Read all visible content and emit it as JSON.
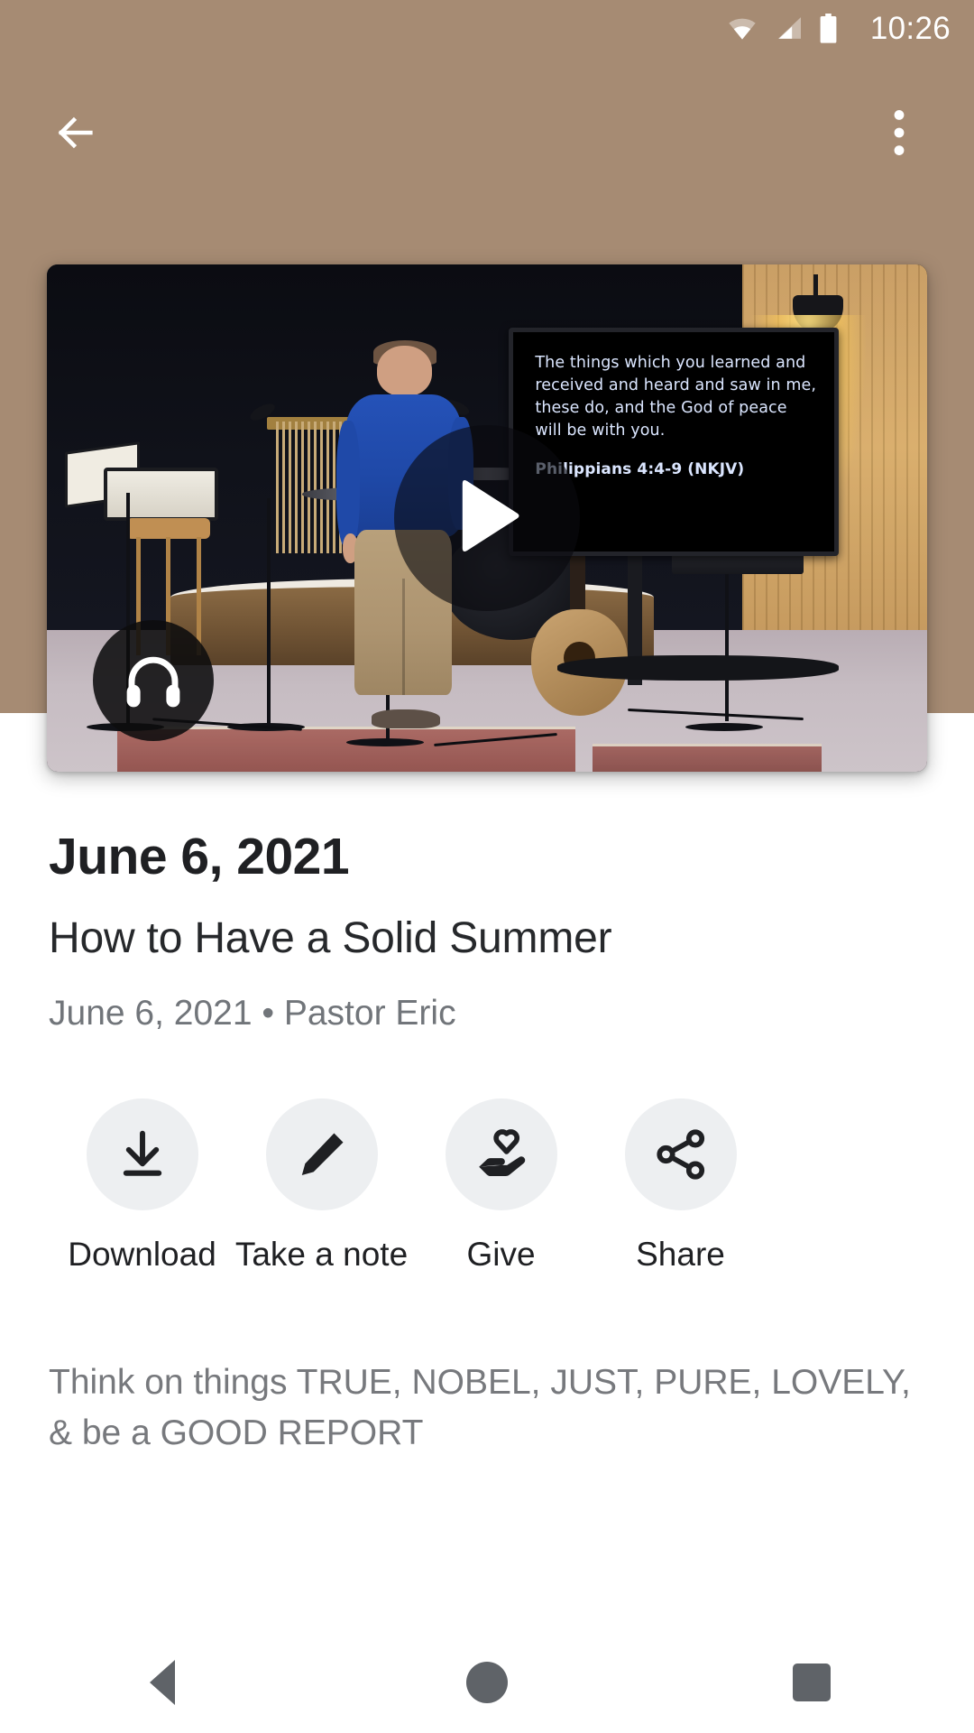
{
  "status_bar": {
    "time": "10:26",
    "icons": [
      "wifi-icon",
      "cellular-signal-icon",
      "battery-icon"
    ]
  },
  "app_bar": {
    "back_icon": "back-arrow-icon",
    "overflow_icon": "more-vertical-icon",
    "background_color": "#a68b73"
  },
  "video": {
    "play_icon": "play-icon",
    "audio_badge_icon": "headphones-icon",
    "slide": {
      "body": "The things which you learned and received and heard and saw in me, these do, and the God of peace will be with you.",
      "reference": "Philippians 4:4-9 (NKJV)"
    }
  },
  "detail": {
    "title": "June 6, 2021",
    "subtitle": "How to Have a Solid Summer",
    "meta": "June 6, 2021 • Pastor Eric",
    "description": "Think on things TRUE, NOBEL, JUST, PURE, LOVELY, & be a GOOD REPORT"
  },
  "actions": [
    {
      "label": "Download",
      "icon": "download-icon"
    },
    {
      "label": "Take a note",
      "icon": "pencil-icon"
    },
    {
      "label": "Give",
      "icon": "hand-heart-icon"
    },
    {
      "label": "Share",
      "icon": "share-nodes-icon"
    }
  ],
  "nav_bar": {
    "back": "back-triangle-icon",
    "home": "home-circle-icon",
    "recents": "recents-square-icon"
  }
}
